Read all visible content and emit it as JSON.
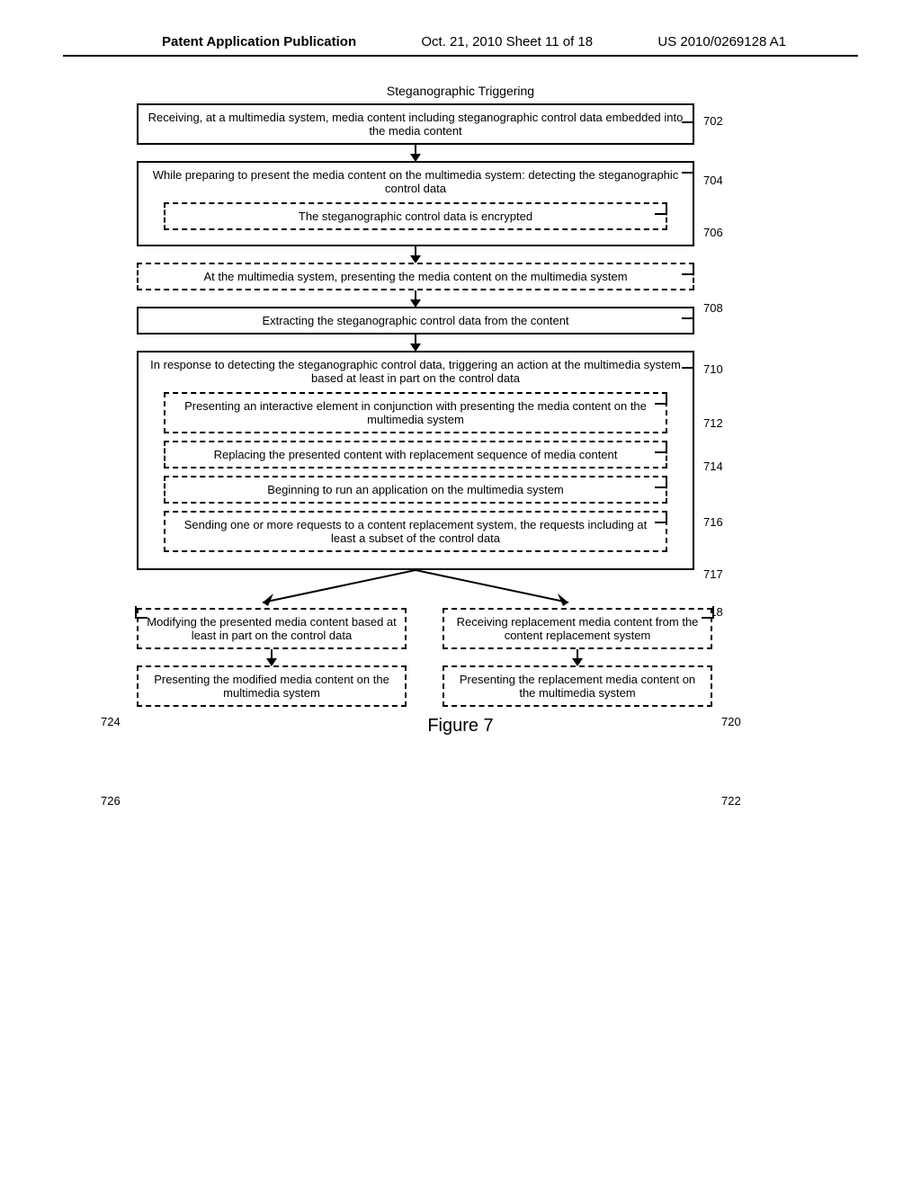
{
  "header": {
    "left": "Patent Application Publication",
    "mid": "Oct. 21, 2010   Sheet 11 of 18",
    "right": "US 2010/0269128 A1"
  },
  "title": "Steganographic Triggering",
  "steps": {
    "s702": "Receiving, at a multimedia system, media content including steganographic control data embedded into the media content",
    "s704": "While preparing to present the media content on the multimedia system: detecting the steganographic control data",
    "s706": "The steganographic control data is encrypted",
    "s708": "At the multimedia system, presenting the media content on the multimedia system",
    "s710": "Extracting the steganographic control data from the content",
    "s712": "In response to detecting the steganographic control data, triggering an action at the multimedia system based at least in part on the control data",
    "s714": "Presenting an interactive element in conjunction with presenting the media content on the multimedia system",
    "s716": "Replacing the presented content with replacement sequence of media content",
    "s717": "Beginning to run an application on the multimedia system",
    "s718": "Sending one or more requests to a content replacement system, the requests including at least a subset of the control data",
    "s720": "Receiving replacement media content from the content replacement system",
    "s722": "Presenting the replacement media content on the multimedia system",
    "s724": "Modifying the presented media content based at least in part on the control data",
    "s726": "Presenting the modified media content on the multimedia system"
  },
  "refs": {
    "r702": "702",
    "r704": "704",
    "r706": "706",
    "r708": "708",
    "r710": "710",
    "r712": "712",
    "r714": "714",
    "r716": "716",
    "r717": "717",
    "r718": "718",
    "r720": "720",
    "r722": "722",
    "r724": "724",
    "r726": "726"
  },
  "figcap": "Figure 7"
}
